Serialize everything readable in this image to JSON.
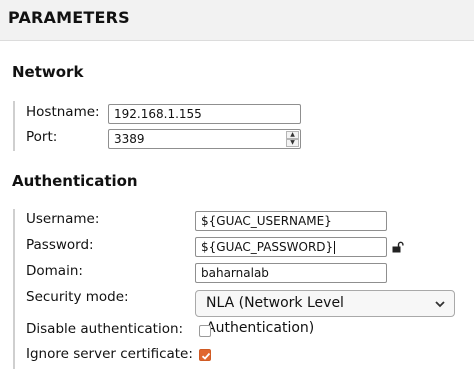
{
  "header": {
    "title": "PARAMETERS"
  },
  "network": {
    "title": "Network",
    "hostname": {
      "label": "Hostname:",
      "value": "192.168.1.155"
    },
    "port": {
      "label": "Port:",
      "value": "3389"
    }
  },
  "authentication": {
    "title": "Authentication",
    "username": {
      "label": "Username:",
      "value": "${GUAC_USERNAME}"
    },
    "password": {
      "label": "Password:",
      "value": "${GUAC_PASSWORD}"
    },
    "domain": {
      "label": "Domain:",
      "value": "baharnalab"
    },
    "security_mode": {
      "label": "Security mode:",
      "value": "NLA (Network Level Authentication)"
    },
    "disable_auth": {
      "label": "Disable authentication:",
      "checked": false
    },
    "ignore_cert": {
      "label": "Ignore server certificate:",
      "checked": true
    }
  },
  "icons": {
    "lock": "unlock-icon",
    "select_arrow": "chevron-down-icon",
    "spinner_up": "up-arrow-icon",
    "spinner_down": "down-arrow-icon",
    "check": "checkmark-icon"
  },
  "colors": {
    "accent": "#e0672f",
    "header_bg": "#f2f2f2"
  }
}
